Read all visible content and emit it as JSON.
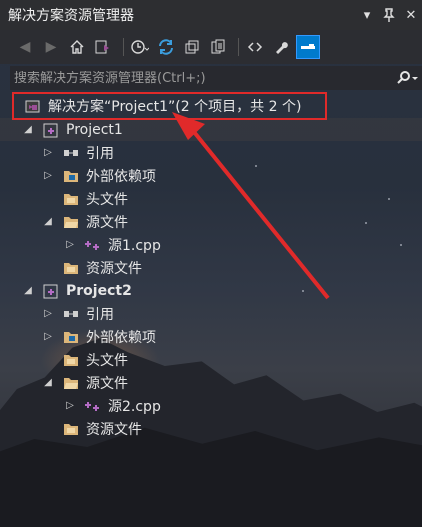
{
  "window": {
    "title": "解决方案资源管理器",
    "buttons": {
      "dropdown": "▾",
      "pin": "ᛣ",
      "close": "✕"
    }
  },
  "toolbar": {
    "icons": [
      "back-icon",
      "forward-icon",
      "home-icon",
      "switch-views-icon",
      "history-icon",
      "sync-icon",
      "collapse-all-icon",
      "show-all-files-icon",
      "view-code-icon",
      "properties-icon",
      "preview-icon"
    ]
  },
  "search": {
    "placeholder": "搜索解决方案资源管理器(Ctrl+;)"
  },
  "tree": {
    "solution_label": "解决方案“Project1”(2 个项目，共 2 个)",
    "project1": {
      "name": "Project1",
      "items": [
        "引用",
        "外部依赖项",
        "头文件",
        "源文件",
        "源1.cpp",
        "资源文件"
      ]
    },
    "project2": {
      "name": "Project2",
      "items": [
        "引用",
        "外部依赖项",
        "头文件",
        "源文件",
        "源2.cpp",
        "资源文件"
      ]
    }
  },
  "colors": {
    "accent": "#007acc",
    "annotation": "#e02a2a",
    "folder": "#dcb67a",
    "project": "#9b4f96"
  }
}
